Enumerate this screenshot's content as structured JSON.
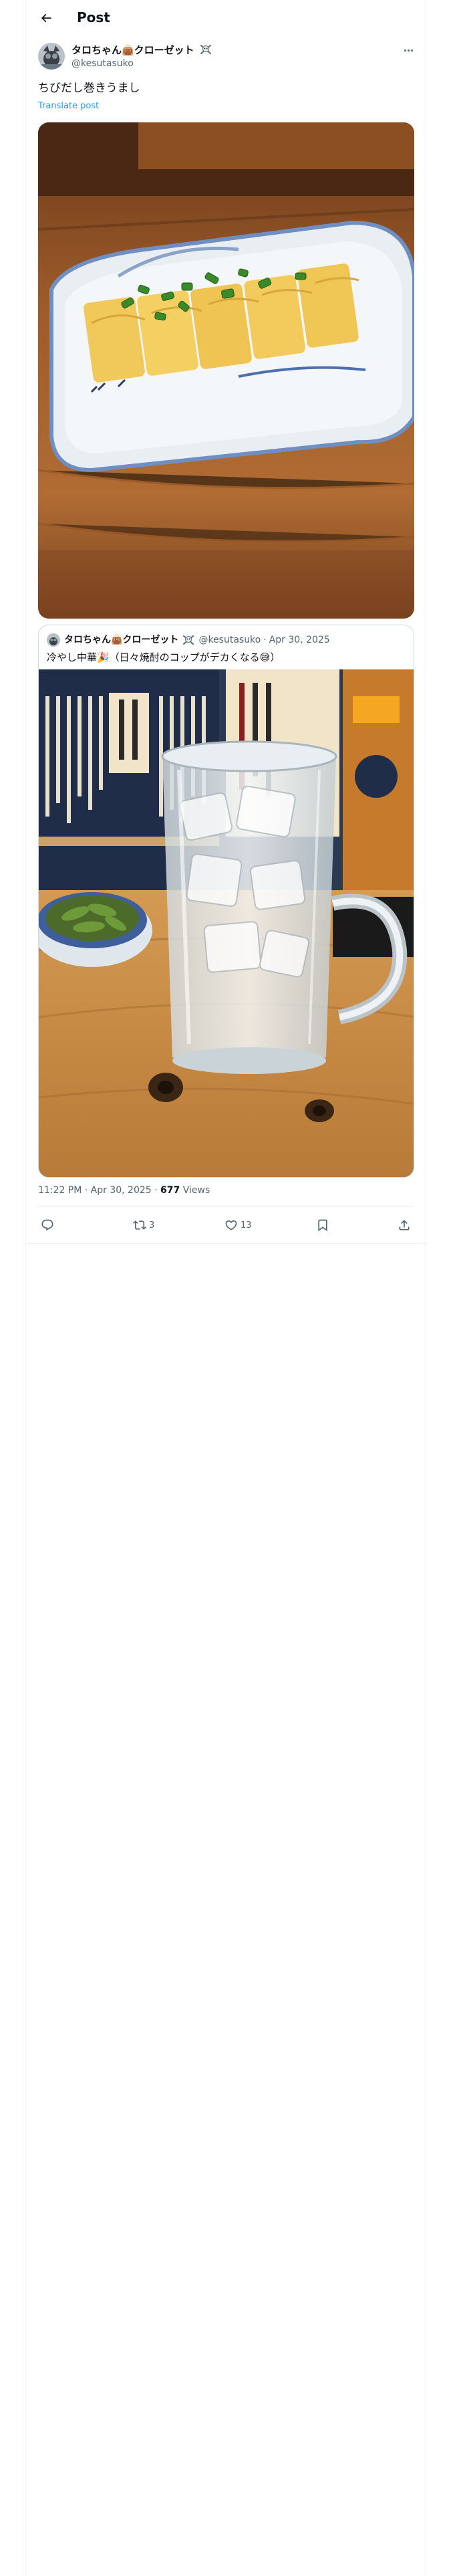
{
  "header": {
    "title": "Post",
    "back_icon": "arrow-left-icon"
  },
  "post": {
    "author": {
      "name": "タロちゃん👜クローゼット",
      "handle": "@kesutasuko",
      "badge_icon": "skull-crossbones-icon"
    },
    "text": "ちびだし巻きうまし",
    "translate_label": "Translate post",
    "image_main": "photo of tamagoyaki rolled omelette on a plate",
    "timestamp": "11:22 PM · Apr 30, 2025",
    "views_count": "677",
    "views_label": "Views"
  },
  "quote": {
    "author": {
      "name": "タロちゃん👜クローゼット",
      "handle": "@kesutasuko",
      "badge_icon": "skull-crossbones-icon"
    },
    "date": "Apr 30, 2025",
    "separator": "·",
    "text": "冷やし中華🎉（日々焼酎のコップがデカくなる😅）",
    "image": "photo of shochu glass with ice and edamame"
  },
  "actions": {
    "reply": {
      "icon": "reply-icon",
      "count": ""
    },
    "repost": {
      "icon": "repost-icon",
      "count": "3"
    },
    "like": {
      "icon": "heart-icon",
      "count": "13"
    },
    "bookmark": {
      "icon": "bookmark-icon",
      "count": ""
    },
    "share": {
      "icon": "share-icon",
      "count": ""
    }
  },
  "colors": {
    "accent": "#1d9bf0",
    "text_primary": "#0f1419",
    "text_secondary": "#536471",
    "border": "#eff3f4"
  }
}
